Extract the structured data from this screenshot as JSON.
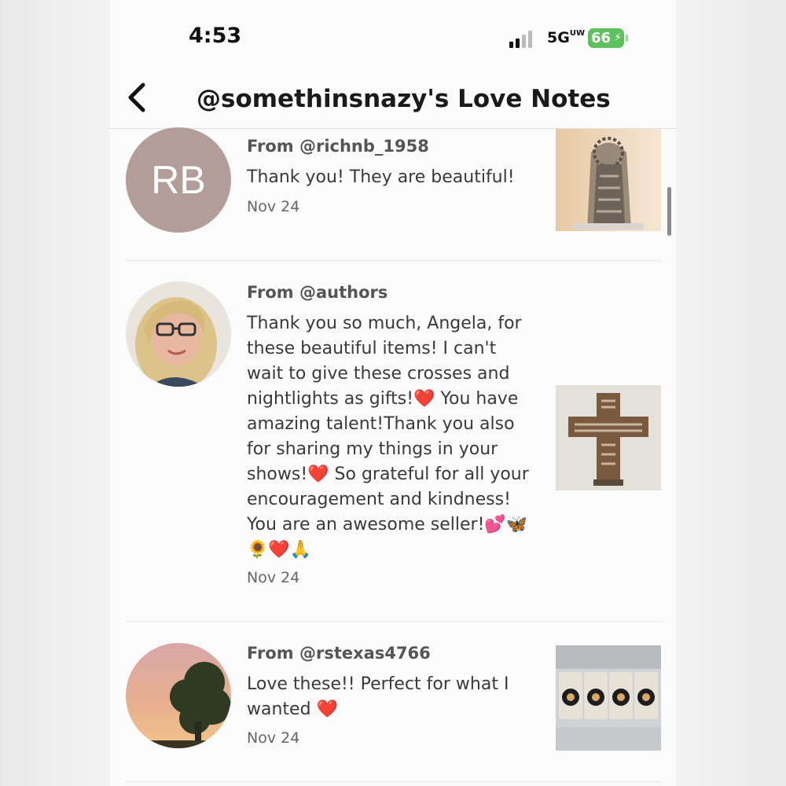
{
  "status_bar": {
    "time": "4:53",
    "network": "5G",
    "network_suffix": "UW",
    "battery": "66"
  },
  "header": {
    "title": "@somethinsnazy's Love Notes",
    "back_icon": "chevron-left-icon"
  },
  "notes": [
    {
      "from": "From @richnb_1958",
      "message": "Thank you! They are beautiful!",
      "date": "Nov 24",
      "avatar_initials": "RB",
      "avatar_color": "#b39d98"
    },
    {
      "from": "From @authors",
      "message": "Thank you so much, Angela, for these beautiful items! I can't wait to give these crosses and nightlights as gifts!❤️ You have amazing talent!Thank you also for sharing my things in your shows!❤️ So grateful for all your encouragement and kindness! You are an awesome seller!💕🦋🌻❤️🙏",
      "date": "Nov 24"
    },
    {
      "from": "From @rstexas4766",
      "message": "Love these!! Perfect for what I wanted ❤️",
      "date": "Nov 24"
    }
  ]
}
